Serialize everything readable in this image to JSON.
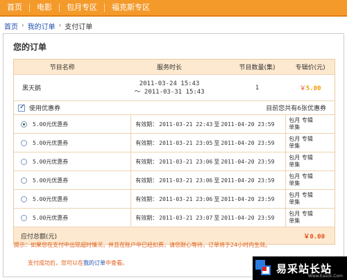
{
  "nav": {
    "items": [
      "首页",
      "电影",
      "包月专区",
      "福克斯专区"
    ]
  },
  "breadcrumb": {
    "home": "首页",
    "orders": "我的订单",
    "current": "支付订单",
    "separator": "›"
  },
  "panel": {
    "title": "您的订单"
  },
  "table": {
    "headers": [
      "节目名称",
      "服务时长",
      "节目数量(集)",
      "专辑价(元)"
    ],
    "product": {
      "name": "黑天鹅",
      "service_start": "2011-03-24 15:43",
      "service_end": "～ 2011-03-31 15:43",
      "quantity": "1",
      "price_currency": "￥",
      "price_value": "5.00"
    }
  },
  "coupons": {
    "use_label": "使用优惠券",
    "use_checked": true,
    "count_text": "目前您共有6张优惠券",
    "valid_label": "有效期：",
    "to_label": "至",
    "rows": [
      {
        "name": "5.00元优惠券",
        "from": "2011-03-21 22:43",
        "to": "2011-04-20 23:59",
        "scope": "包月 专辑 单集",
        "selected": true
      },
      {
        "name": "5.00元优惠券",
        "from": "2011-03-21 23:05",
        "to": "2011-04-20 23:59",
        "scope": "包月 专辑 单集",
        "selected": false
      },
      {
        "name": "5.00元优惠券",
        "from": "2011-03-21 23:06",
        "to": "2011-04-20 23:59",
        "scope": "包月 专辑 单集",
        "selected": false
      },
      {
        "name": "5.00元优惠券",
        "from": "2011-03-21 23:06",
        "to": "2011-04-20 23:59",
        "scope": "包月 专辑 单集",
        "selected": false
      },
      {
        "name": "5.00元优惠券",
        "from": "2011-03-21 23:06",
        "to": "2011-04-20 23:59",
        "scope": "包月 专辑 单集",
        "selected": false
      },
      {
        "name": "5.00元优惠券",
        "from": "2011-03-21 23:07",
        "to": "2011-04-20 23:59",
        "scope": "包月 专辑 单集",
        "selected": false
      }
    ]
  },
  "total": {
    "label": "应付总额(元)",
    "currency": "￥",
    "value": "0.00"
  },
  "tips": {
    "line1": "提示：如果您在支付中出现超时情况，并且在账户中已经扣费，请您耐心等待，订单将于24小时内生效。",
    "line2_pre": "支付成功后，您可以在",
    "line2_link": "我的订单",
    "line2_post": "中查看。"
  },
  "watermark": {
    "text": "易采站长站",
    "sub": "Www.Easck.Com"
  },
  "colors": {
    "nav_bg": "#f49a2b",
    "header_bg": "#fde9cf",
    "link": "#1f4fb0",
    "price": "#e0511d",
    "tip": "#e05a13"
  }
}
